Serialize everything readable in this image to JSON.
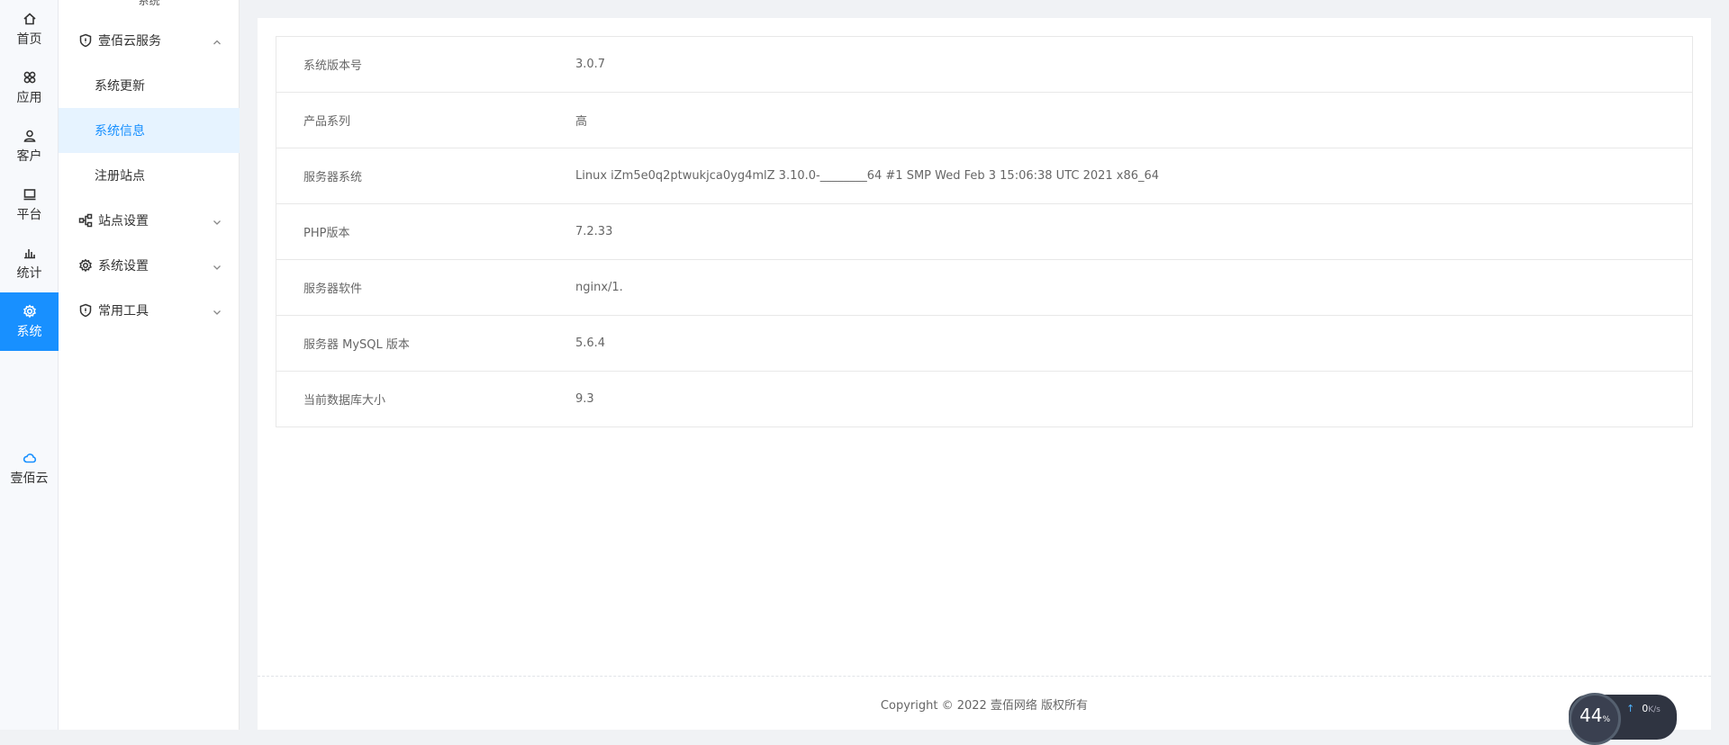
{
  "rail": {
    "items": [
      {
        "label": "首页",
        "icon": "home-icon"
      },
      {
        "label": "应用",
        "icon": "apps-icon"
      },
      {
        "label": "客户",
        "icon": "user-icon"
      },
      {
        "label": "平台",
        "icon": "monitor-icon"
      },
      {
        "label": "统计",
        "icon": "bar-chart-icon"
      },
      {
        "label": "系统",
        "icon": "gear-icon",
        "active": true
      }
    ],
    "cloud": {
      "label": "壹佰云",
      "icon": "cloud-icon"
    }
  },
  "submenu": {
    "header": "系统",
    "groups": [
      {
        "label": "壹佰云服务",
        "icon": "shield-icon",
        "expanded": true,
        "children": [
          "系统更新",
          "系统信息",
          "注册站点"
        ],
        "active_child": "系统信息"
      },
      {
        "label": "站点设置",
        "icon": "sitemap-icon",
        "expanded": false
      },
      {
        "label": "系统设置",
        "icon": "gear-icon",
        "expanded": false
      },
      {
        "label": "常用工具",
        "icon": "shield-icon",
        "expanded": false
      }
    ]
  },
  "info": {
    "rows": [
      {
        "label": "系统版本号",
        "value": "3.0.7"
      },
      {
        "label": "产品系列",
        "value": "高"
      },
      {
        "label": "服务器系统",
        "value": "Linux iZm5e0q2ptwukjca0yg4mlZ 3.10.0-________64 #1 SMP Wed Feb 3 15:06:38 UTC 2021 x86_64"
      },
      {
        "label": "PHP版本",
        "value": "7.2.33"
      },
      {
        "label": "服务器软件",
        "value": "nginx/1."
      },
      {
        "label": "服务器 MySQL 版本",
        "value": "5.6.4"
      },
      {
        "label": "当前数据库大小",
        "value": "9.3"
      }
    ]
  },
  "footer": {
    "copyright": "Copyright © 2022 壹佰网络 版权所有"
  },
  "speed": {
    "percent": "44",
    "percent_unit": "%",
    "rate": "0",
    "rate_unit": "K/s"
  },
  "colors": {
    "accent": "#1890ff",
    "active_bg": "#e6f3ff"
  }
}
